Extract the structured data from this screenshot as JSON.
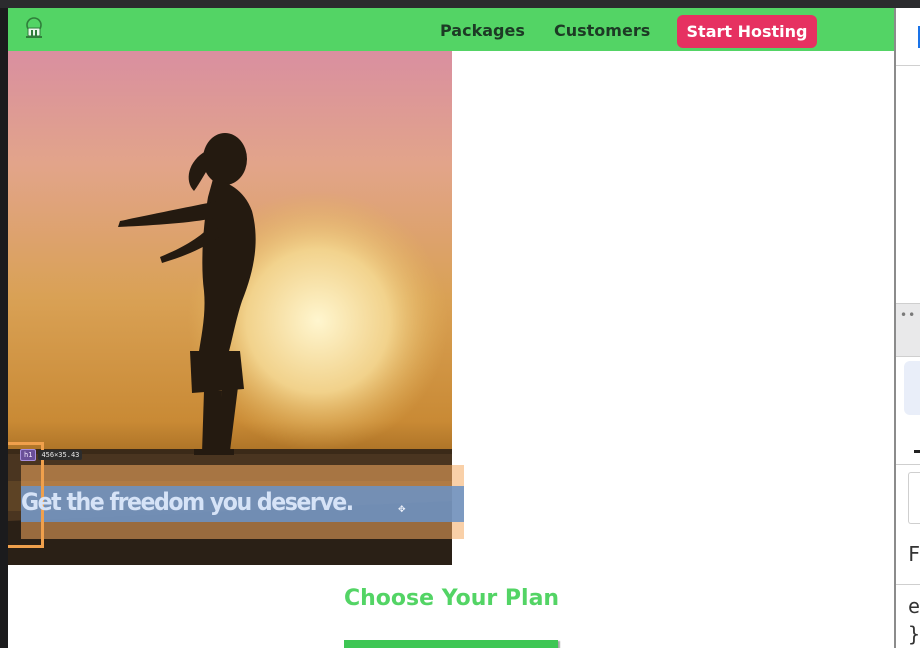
{
  "navbar": {
    "links": [
      "Packages",
      "Customers"
    ],
    "cta_label": "Start Hosting"
  },
  "hero": {
    "headline": "Get the freedom you deserve.",
    "inspector": {
      "tag": "h1",
      "size_label": "456×35.43"
    }
  },
  "section": {
    "title": "Choose Your Plan"
  },
  "devtools": {
    "dots": "••",
    "lines": [
      "F",
      "e",
      "}"
    ]
  },
  "colors": {
    "navbar": "#53d465",
    "cta": "#e63161",
    "accent_green": "#53d465",
    "highlight_content": "#6b92c4",
    "highlight_margin": "#f4aa60"
  }
}
